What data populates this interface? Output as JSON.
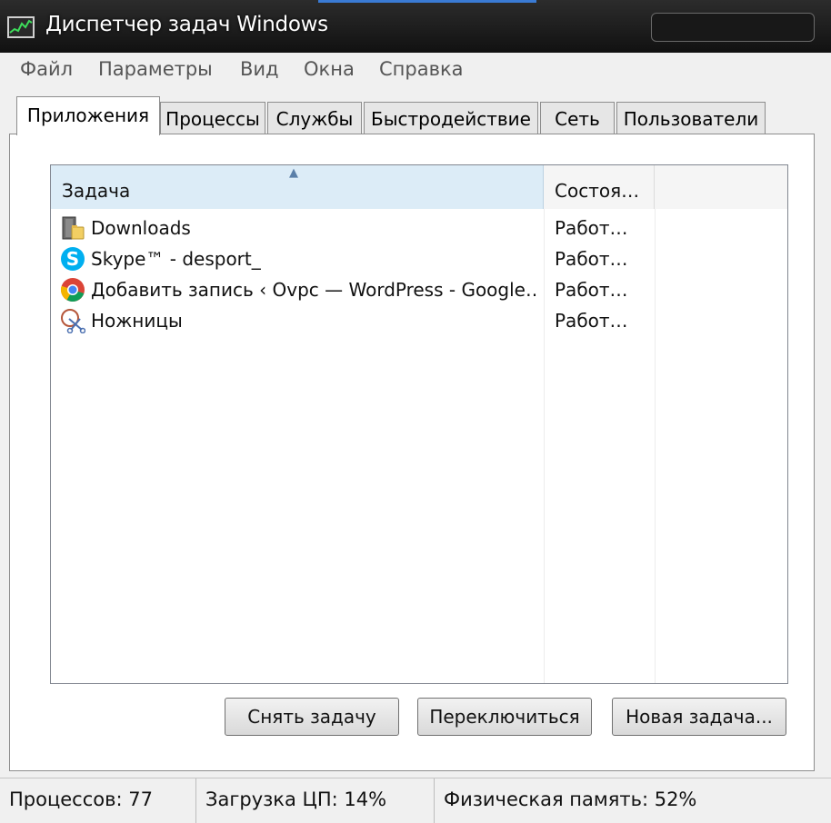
{
  "window": {
    "title": "Диспетчер задач Windows"
  },
  "menu": [
    "Файл",
    "Параметры",
    "Вид",
    "Окна",
    "Справка"
  ],
  "tabs": [
    "Приложения",
    "Процессы",
    "Службы",
    "Быстродействие",
    "Сеть",
    "Пользователи"
  ],
  "active_tab": "Приложения",
  "table": {
    "columns": [
      "Задача",
      "Состоя…"
    ],
    "rows": [
      {
        "name": "Downloads",
        "status": "Работ…",
        "icon": "folder-icon"
      },
      {
        "name": "Skype™ - desport_",
        "status": "Работ…",
        "icon": "skype-icon"
      },
      {
        "name": "Добавить запись ‹ Ovpc — WordPress - Google…",
        "status": "Работ…",
        "icon": "chrome-icon"
      },
      {
        "name": "Ножницы",
        "status": "Работ…",
        "icon": "scissors-icon"
      }
    ]
  },
  "buttons": {
    "end_task": "Снять задачу",
    "switch_to": "Переключиться",
    "new_task": "Новая задача..."
  },
  "statusbar": {
    "processes": "Процессов: 77",
    "cpu": "Загрузка ЦП: 14%",
    "memory": "Физическая память: 52%"
  },
  "colors": {
    "titlebar": "#1a1a1a",
    "window_bg": "#f0f0f0",
    "header_selected": "#dcecf7",
    "skype_blue": "#00aff0"
  }
}
